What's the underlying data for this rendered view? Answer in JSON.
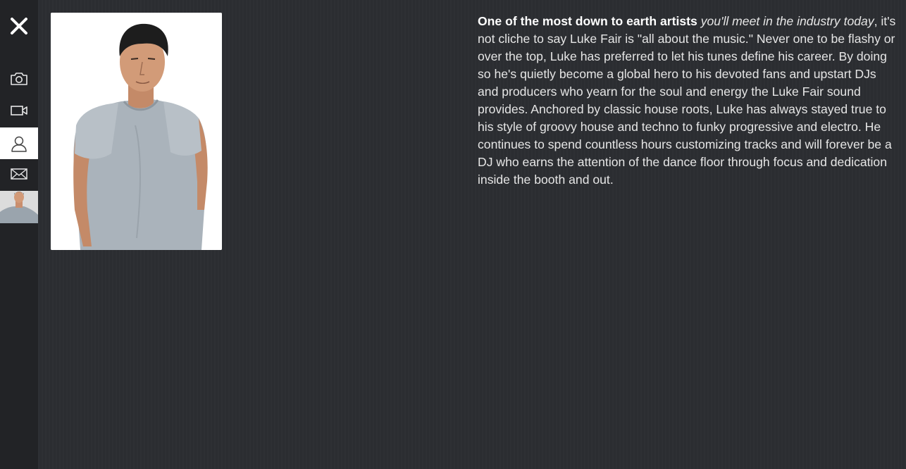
{
  "sidebar": {
    "close_label": "Close",
    "items": [
      {
        "icon": "camera-icon",
        "active": false
      },
      {
        "icon": "video-icon",
        "active": false
      },
      {
        "icon": "user-icon",
        "active": true
      },
      {
        "icon": "mail-icon",
        "active": false
      }
    ]
  },
  "bio": {
    "lead_bold": "One of the most down to earth artists",
    "lead_italic": "you'll meet in the industry today",
    "body": ", it's not cliche to say Luke Fair is \"all about the music.\" Never one to be flashy or over the top, Luke has preferred to let his tunes define his career. By doing so he's quietly become a global hero to his devoted fans and upstart DJs and producers who yearn for the soul and energy the Luke Fair sound provides. Anchored by classic house roots, Luke has always stayed true to his style of groovy house and techno to funky progressive and electro. He continues to spend countless hours customizing tracks and will forever be a DJ who earns the attention of the dance floor through focus and dedication inside the booth and out."
  },
  "colors": {
    "background": "#2c2e32",
    "sidebar": "#222326",
    "active_item": "#ffffff",
    "text": "#e6e6e6"
  }
}
